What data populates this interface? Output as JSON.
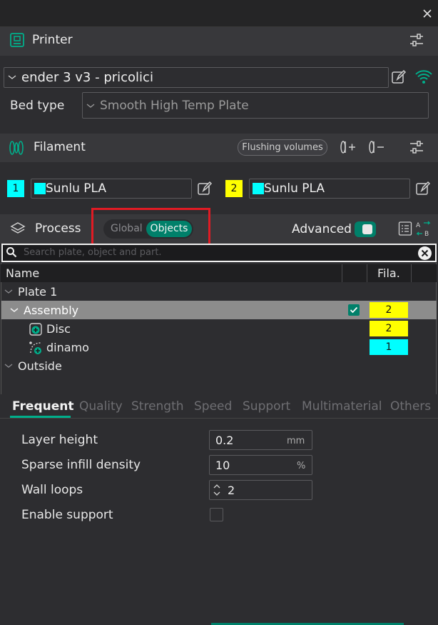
{
  "printer": {
    "title": "Printer",
    "preset": "ender 3 v3 - pricolici",
    "bed_type_label": "Bed type",
    "bed_type_value": "Smooth High Temp Plate"
  },
  "filament": {
    "title": "Filament",
    "flushing_label": "Flushing volumes",
    "slots": [
      {
        "num": "1",
        "name": "Sunlu PLA",
        "num_color": "#00ffff",
        "color": "#00ffff"
      },
      {
        "num": "2",
        "name": "Sunlu PLA",
        "num_color": "#ffff00",
        "color": "#00ffff"
      }
    ]
  },
  "process": {
    "title": "Process",
    "toggle_global": "Global",
    "toggle_objects": "Objects",
    "advanced_label": "Advanced"
  },
  "search": {
    "placeholder": "Search plate, object and part."
  },
  "object_list": {
    "col_name": "Name",
    "col_fila": "Fila.",
    "rows": [
      {
        "label": "Plate 1"
      },
      {
        "label": "Assembly",
        "fila": "2",
        "fila_color": "#ffff00"
      },
      {
        "label": "Disc",
        "fila": "2",
        "fila_color": "#ffff00"
      },
      {
        "label": "dinamo",
        "fila": "1",
        "fila_color": "#00ffff"
      },
      {
        "label": "Outside"
      }
    ]
  },
  "tabs": [
    "Frequent",
    "Quality",
    "Strength",
    "Speed",
    "Support",
    "Multimaterial",
    "Others"
  ],
  "params": [
    {
      "label": "Layer height",
      "value": "0.2",
      "unit": "mm"
    },
    {
      "label": "Sparse infill density",
      "value": "10",
      "unit": "%"
    },
    {
      "label": "Wall loops",
      "value": "2"
    },
    {
      "label": "Enable support"
    }
  ],
  "colors": {
    "accent": "#00ae8b",
    "highlight_box": "#e01b24",
    "selected_row": "#8c8c8c"
  }
}
